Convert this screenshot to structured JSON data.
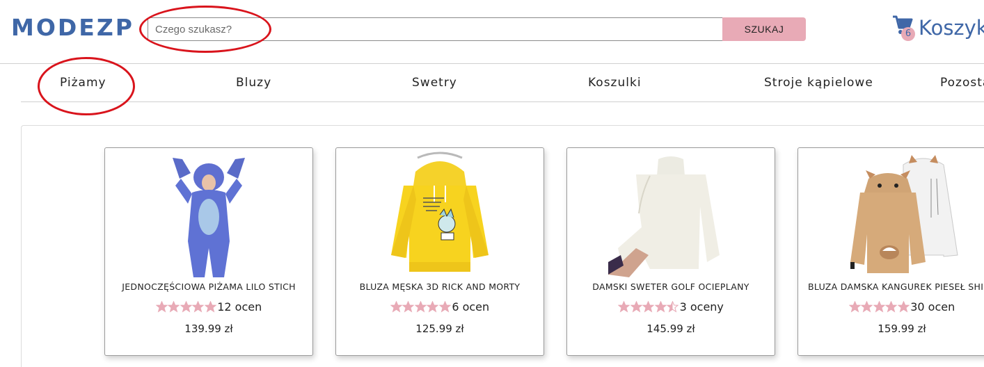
{
  "header": {
    "logo": "MODEZP",
    "search_placeholder": "Czego szukasz?",
    "search_button": "SZUKAJ",
    "cart_count": "6",
    "cart_label": "Koszyk"
  },
  "nav": {
    "items": [
      {
        "label": "Piżamy"
      },
      {
        "label": "Bluzy"
      },
      {
        "label": "Swetry"
      },
      {
        "label": "Koszulki"
      },
      {
        "label": "Stroje kąpielowe"
      },
      {
        "label": "Pozostałe"
      }
    ]
  },
  "products": [
    {
      "name": "JEDNOCZĘŚCIOWA PIŻAMA LILO STICH",
      "rating": 5,
      "rating_text": "12 ocen",
      "price": "139.99 zł",
      "image_icon": "stitch-onesie-image"
    },
    {
      "name": "BLUZA MĘSKA 3D RICK AND MORTY",
      "rating": 5,
      "rating_text": "6 ocen",
      "price": "125.99 zł",
      "image_icon": "yellow-hoodie-image"
    },
    {
      "name": "DAMSKI SWETER GOLF OCIEPLANY",
      "rating": 4.5,
      "rating_text": "3 oceny",
      "price": "145.99 zł",
      "image_icon": "white-turtleneck-image"
    },
    {
      "name": "BLUZA DAMSKA KANGUREK PIESEŁ SHIBA",
      "rating": 5,
      "rating_text": "30 ocen",
      "price": "159.99 zł",
      "image_icon": "shiba-hoodie-image"
    }
  ],
  "colors": {
    "brand": "#3f67a7",
    "accent_pink": "#e8aab6",
    "star": "#e8aab6",
    "annotation": "#d9141c"
  }
}
